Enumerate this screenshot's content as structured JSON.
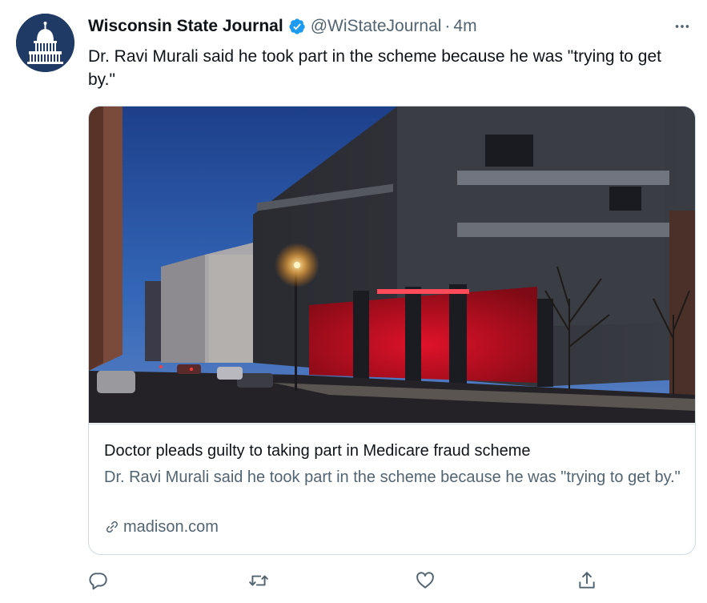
{
  "tweet": {
    "display_name": "Wisconsin State Journal",
    "handle": "@WiStateJournal",
    "separator": "·",
    "time": "4m",
    "text": "Dr. Ravi Murali said he took part in the scheme because he was \"trying to get by.\""
  },
  "card": {
    "title": "Doctor pleads guilty to taking part in Medicare fraud scheme",
    "description": "Dr. Ravi Murali said he took part in the scheme because he was \"trying to get by.\"",
    "domain": "madison.com"
  },
  "icons": {
    "avatar": "capitol-dome-logo",
    "verified": "verified-badge-icon",
    "more": "more-icon",
    "link": "link-icon",
    "reply": "reply-icon",
    "retweet": "retweet-icon",
    "like": "like-icon",
    "share": "share-icon"
  },
  "colors": {
    "avatar_bg": "#1f3a64",
    "verified": "#1d9bf0",
    "secondary_text": "#536471",
    "border": "#cfd9de"
  }
}
